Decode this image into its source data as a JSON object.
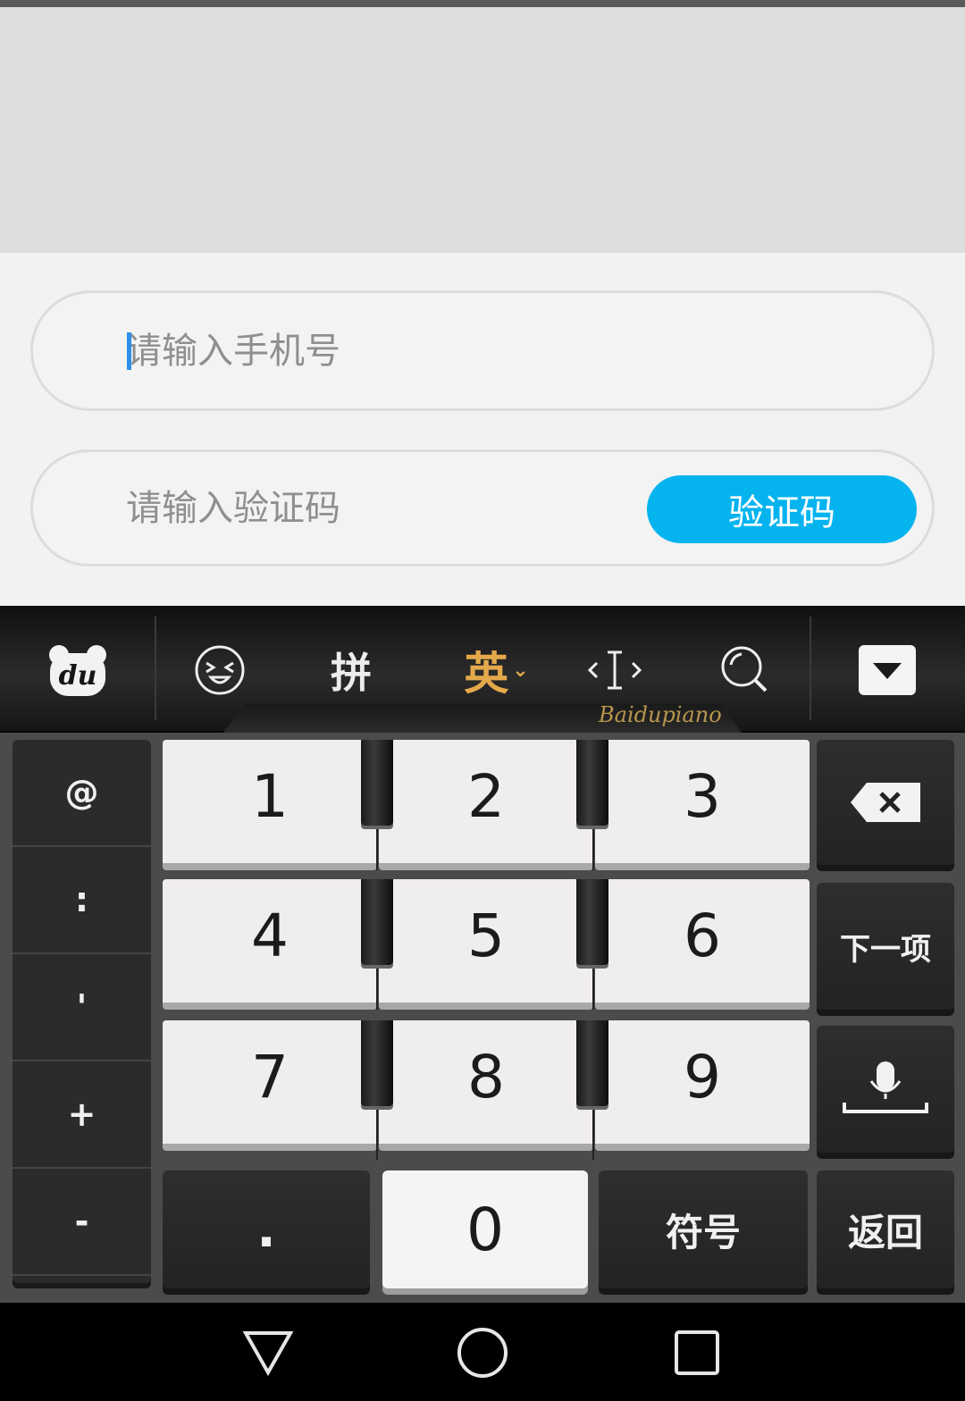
{
  "form": {
    "phone_placeholder": "请输入手机号",
    "code_placeholder": "请输入验证码",
    "code_button": "验证码"
  },
  "keyboard": {
    "toolbar": {
      "logo_text": "du",
      "pinyin": "拼",
      "english": "英",
      "brand": "Baidupiano"
    },
    "side_keys": [
      "@",
      ":",
      "'",
      "+",
      "-"
    ],
    "digits": [
      "1",
      "2",
      "3",
      "4",
      "5",
      "6",
      "7",
      "8",
      "9"
    ],
    "bottom": {
      "dot": ".",
      "zero": "0",
      "symbols": "符号",
      "back": "返回"
    },
    "next": "下一项"
  },
  "colors": {
    "accent": "#05b4ef",
    "caret": "#2f8ee8",
    "active_mode": "#e4a94b"
  },
  "icons": [
    "emoji-icon",
    "cursor-move-icon",
    "search-icon",
    "hide-keyboard-icon",
    "backspace-icon",
    "microphone-icon",
    "back-triangle-icon",
    "home-circle-icon",
    "recents-square-icon"
  ]
}
